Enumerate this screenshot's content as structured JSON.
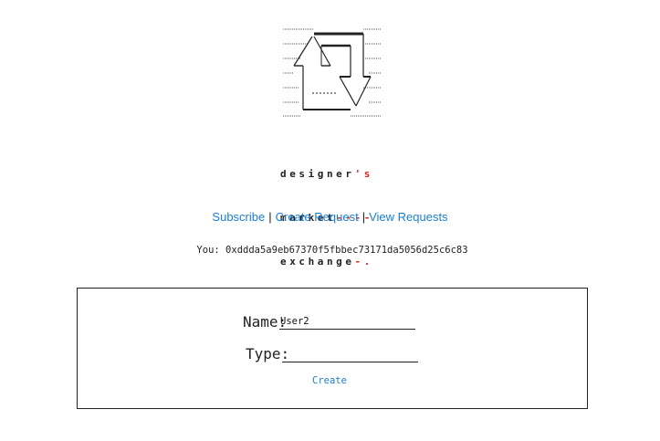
{
  "logo": {
    "icon": "up-down-arrows-ascii-logo-icon"
  },
  "wordmark": {
    "line1": "designer",
    "line1_accent": "'s",
    "line2": "market",
    "line2_accent": "----",
    "line3": "exchange",
    "line3_accent": "-."
  },
  "nav": {
    "subscribe": "Subscribe",
    "create_request": "Create Request",
    "view_requests": "View Requests",
    "separator": "|"
  },
  "account": {
    "label": "You:",
    "address": "0xddda5a9eb67370f5fbbec73171da5056d25c6c83"
  },
  "form": {
    "name_label": "Name:",
    "name_value": "User2",
    "type_label": "Type:",
    "type_value": "",
    "create_label": "Create"
  },
  "colors": {
    "link": "#1a7fd1",
    "accent": "#e02020",
    "text": "#222222"
  }
}
